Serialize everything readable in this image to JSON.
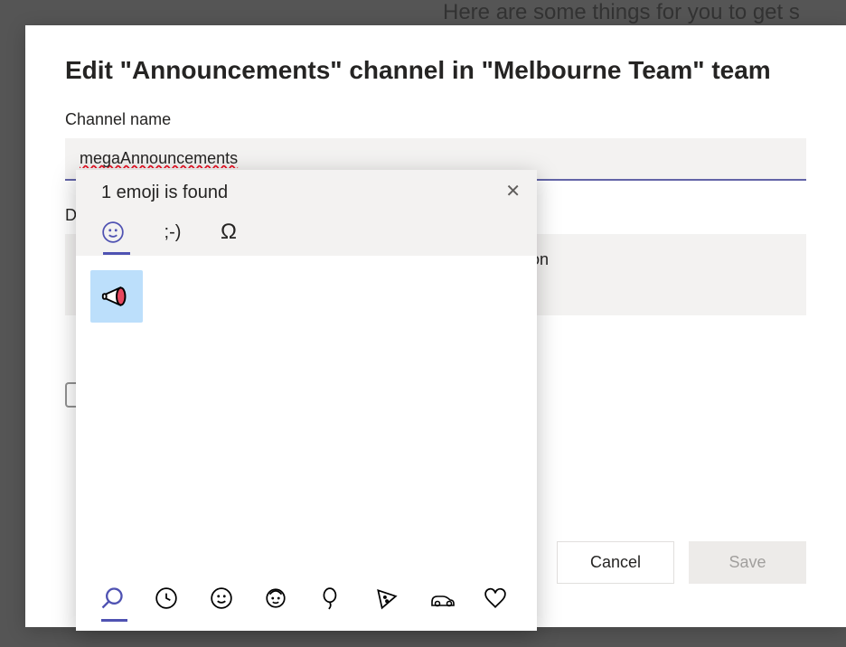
{
  "backdrop": {
    "partial_text": "Here are some things for you to get s"
  },
  "dialog": {
    "title": "Edit \"Announcements\" channel in \"Melbourne Team\" team",
    "channel_name_label": "Channel name",
    "channel_name_value": "megaAnnouncements",
    "description_label_visible": "De",
    "description_placeholder_visible": "ption",
    "actions": {
      "cancel": "Cancel",
      "save": "Save"
    }
  },
  "emoji_picker": {
    "status": "1 emoji is found",
    "tabs": {
      "emoji": "emoji",
      "emoticon_text": ";-)",
      "symbol": "omega"
    },
    "active_tab": "emoji",
    "result": {
      "name": "megaphone"
    },
    "footer_categories": [
      "search",
      "recent",
      "smileys",
      "people",
      "food",
      "activity",
      "travel",
      "objects"
    ],
    "active_footer": "search"
  }
}
